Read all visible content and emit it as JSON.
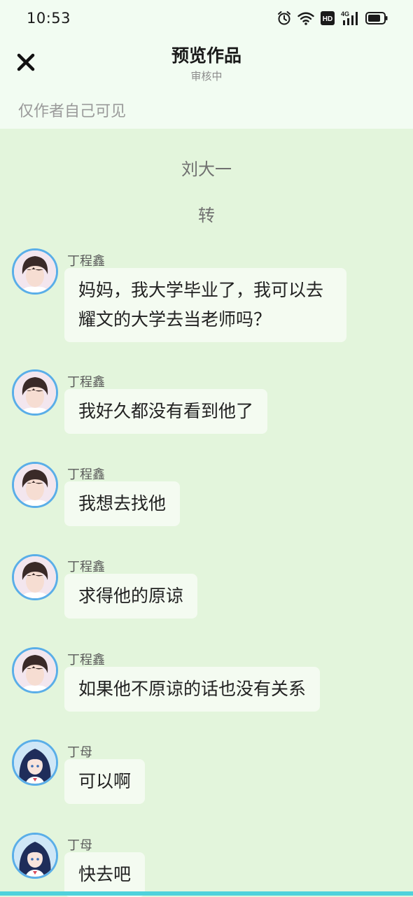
{
  "status_bar": {
    "time": "10:53",
    "hd_label": "HD",
    "network_label": "4G"
  },
  "header": {
    "title": "预览作品",
    "subtitle": "审核中",
    "visibility_note": "仅作者自己可见"
  },
  "story": {
    "title": "刘大一",
    "subtitle": "转"
  },
  "messages": [
    {
      "sender": "丁程鑫",
      "text": "妈妈，我大学毕业了，我可以去耀文的大学去当老师吗？",
      "avatar": "boy-avatar"
    },
    {
      "sender": "丁程鑫",
      "text": "我好久都没有看到他了",
      "avatar": "boy-avatar"
    },
    {
      "sender": "丁程鑫",
      "text": "我想去找他",
      "avatar": "boy-avatar"
    },
    {
      "sender": "丁程鑫",
      "text": "求得他的原谅",
      "avatar": "boy-avatar"
    },
    {
      "sender": "丁程鑫",
      "text": "如果他不原谅的话也没有关系",
      "avatar": "boy-avatar"
    },
    {
      "sender": "丁母",
      "text": "可以啊",
      "avatar": "anime-girl-avatar"
    },
    {
      "sender": "丁母",
      "text": "快去吧",
      "avatar": "anime-girl-avatar"
    }
  ],
  "icons": {
    "close": "close-icon",
    "alarm": "alarm-icon",
    "wifi": "wifi-icon",
    "signal": "signal-icon",
    "battery": "battery-icon"
  },
  "colors": {
    "chat_background": "#e3f5dc",
    "header_background": "#f2fcf2",
    "bubble_background": "#f4fbf1",
    "avatar_ring": "#5aaee8",
    "bottom_strip": "#4fd2dc"
  }
}
